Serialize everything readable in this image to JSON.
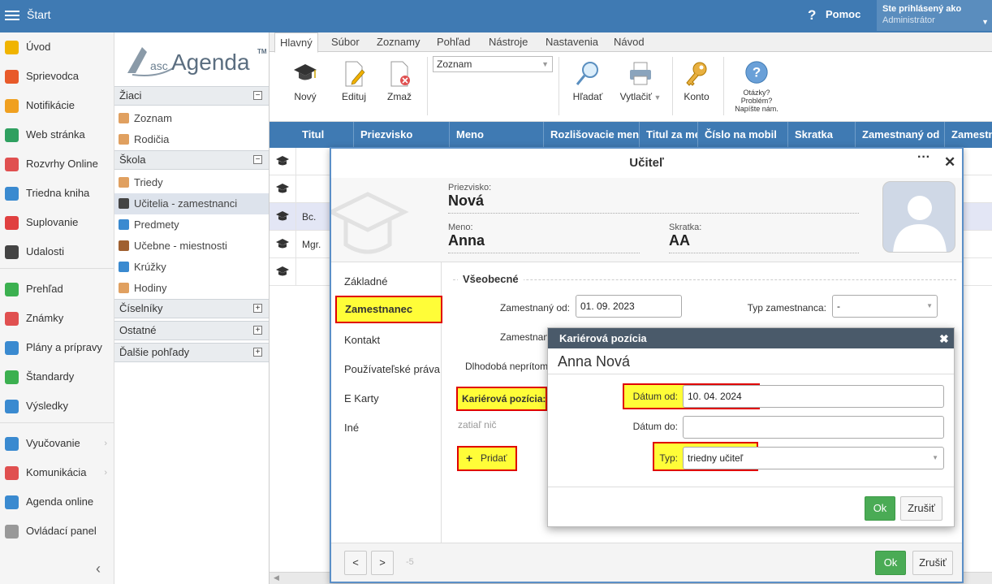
{
  "topbar": {
    "start": "Štart",
    "help_icon": "?",
    "help": "Pomoc",
    "logged_in_as": "Ste prihlásený ako",
    "user": "Administrátor"
  },
  "leftnav": [
    {
      "label": "Úvod",
      "icon": "star-icon",
      "color": "#f0b400"
    },
    {
      "label": "Sprievodca",
      "icon": "wand-icon",
      "color": "#e85a2a"
    },
    {
      "label": "Notifikácie",
      "icon": "envelope-icon",
      "color": "#f0a020"
    },
    {
      "label": "Web stránka",
      "icon": "home-icon",
      "color": "#2fa060"
    },
    {
      "label": "Rozvrhy Online",
      "icon": "grid-icon",
      "color": "#e05050"
    },
    {
      "label": "Triedna kniha",
      "icon": "book-icon",
      "color": "#3a8ad0"
    },
    {
      "label": "Suplovanie",
      "icon": "person-icon",
      "color": "#e04040"
    },
    {
      "label": "Udalosti",
      "icon": "calendar-icon",
      "color": "#444444"
    },
    {
      "label": "Prehľad",
      "icon": "check-circle-icon",
      "color": "#3cb050"
    },
    {
      "label": "Známky",
      "icon": "grade-icon",
      "color": "#e05050"
    },
    {
      "label": "Plány a prípravy",
      "icon": "briefcase-icon",
      "color": "#3a8ad0"
    },
    {
      "label": "Štandardy",
      "icon": "shield-icon",
      "color": "#3cb050"
    },
    {
      "label": "Výsledky",
      "icon": "bar-chart-icon",
      "color": "#3a8ad0"
    },
    {
      "label": "Vyučovanie",
      "icon": "open-book-icon",
      "color": "#3a8ad0",
      "arrow": "›"
    },
    {
      "label": "Komunikácia",
      "icon": "chat-icon",
      "color": "#e05050",
      "arrow": "›"
    },
    {
      "label": "Agenda online",
      "icon": "pen-icon",
      "color": "#3a8ad0"
    },
    {
      "label": "Ovládací panel",
      "icon": "gear-icon",
      "color": "#999999"
    }
  ],
  "collapse_glyph": "‹",
  "logo": {
    "asc": "asc",
    "agenda": "Agenda",
    "tm": "TM"
  },
  "tree": {
    "groups": [
      {
        "label": "Žiaci",
        "toggle": "−",
        "items": [
          {
            "label": "Zoznam",
            "color": "#e0a060"
          },
          {
            "label": "Rodičia",
            "color": "#e0a060"
          }
        ]
      },
      {
        "label": "Škola",
        "toggle": "−",
        "items": [
          {
            "label": "Triedy",
            "color": "#e0a060"
          },
          {
            "label": "Učitelia - zamestnanci",
            "color": "#444444",
            "selected": true
          },
          {
            "label": "Predmety",
            "color": "#3a8ad0"
          },
          {
            "label": "Učebne - miestnosti",
            "color": "#a06030"
          },
          {
            "label": "Krúžky",
            "color": "#3a8ad0"
          },
          {
            "label": "Hodiny",
            "color": "#e0a060"
          }
        ]
      },
      {
        "label": "Číselníky",
        "toggle": "+"
      },
      {
        "label": "Ostatné",
        "toggle": "+"
      },
      {
        "label": "Ďalšie pohľady",
        "toggle": "+"
      }
    ]
  },
  "ribbon": {
    "tabs": [
      "Hlavný",
      "Súbor",
      "Zoznamy",
      "Pohľad",
      "Nástroje",
      "Nastavenia",
      "Návod"
    ],
    "new": "Nový",
    "edit": "Edituj",
    "delete": "Zmaž",
    "view_combo": "Zoznam",
    "find": "Hľadať",
    "print": "Vytlačiť",
    "account": "Konto",
    "help_lines": [
      "Otázky?",
      "Problém?",
      "Napíšte nám."
    ]
  },
  "grid": {
    "columns": [
      "Titul",
      "Priezvisko",
      "Meno",
      "Rozlišovacie meno",
      "Titul za me",
      "Číslo na mobil",
      "Skratka",
      "Zamestnaný od",
      "Zamestn"
    ],
    "rows": [
      {
        "title": ""
      },
      {
        "title": ""
      },
      {
        "title": "Bc."
      },
      {
        "title": "Mgr."
      },
      {
        "title": ""
      }
    ]
  },
  "dialog": {
    "title": "Učiteľ",
    "more": "···",
    "close": "✕",
    "surname_label": "Priezvisko:",
    "surname": "Nová",
    "name_label": "Meno:",
    "name": "Anna",
    "abbr_label": "Skratka:",
    "abbr": "AA",
    "sidenav": [
      "Základné",
      "Zamestnanec",
      "Kontakt",
      "Používateľské práva",
      "E Karty",
      "Iné"
    ],
    "section": "Všeobecné",
    "employed_from_label": "Zamestnaný od:",
    "employed_from": "01. 09. 2023",
    "employment_type_label": "Typ zamestnanca:",
    "employment_type": "-",
    "employed_to_label": "Zamestnan",
    "long_absence_label": "Dlhodobá neprítom",
    "career_label": "Kariérová pozícia:",
    "nothing_yet": "zatiaľ nič",
    "add_button": "Pridať",
    "add_glyph": "+",
    "page_number": "-5",
    "ok": "Ok",
    "cancel": "Zrušiť"
  },
  "subdialog": {
    "title": "Kariérová pozícia",
    "close": "✖",
    "person": "Anna Nová",
    "date_from_label": "Dátum od:",
    "date_from": "10. 04. 2024",
    "date_to_label": "Dátum do:",
    "date_to": "",
    "type_label": "Typ:",
    "type": "triedny učiteľ",
    "ok": "Ok",
    "cancel": "Zrušiť"
  }
}
